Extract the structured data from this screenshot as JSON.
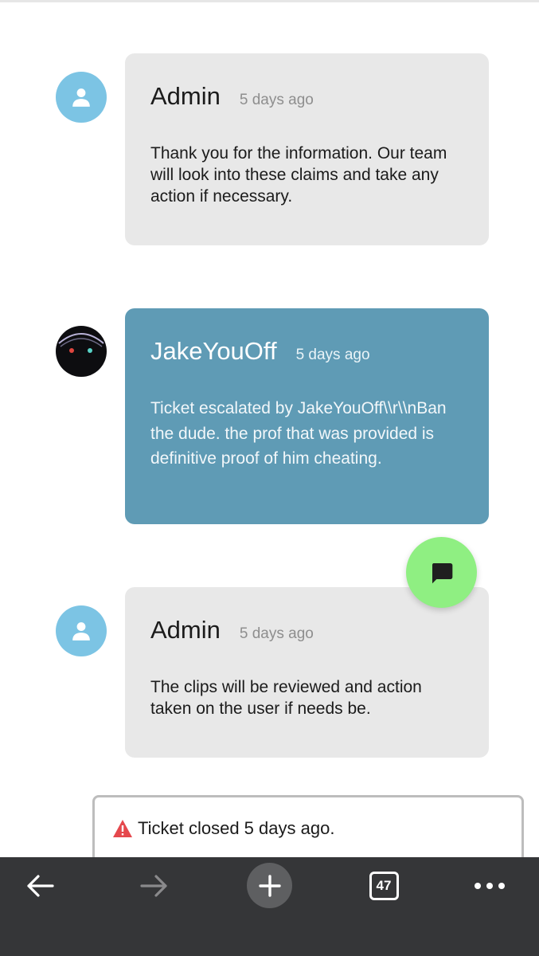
{
  "messages": [
    {
      "author": "Admin",
      "time": "5 days ago",
      "text": "Thank you for the information. Our team will look into these claims and take any action if necessary."
    },
    {
      "author": "JakeYouOff",
      "time": "5 days ago",
      "text": "Ticket escalated by JakeYouOff\\\\r\\\\nBan the dude. the prof that was provided is definitive proof of him cheating."
    },
    {
      "author": "Admin",
      "time": "5 days ago",
      "text": "The clips will be reviewed and action taken on the user if needs be."
    }
  ],
  "ticket_status": {
    "text": "Ticket closed 5 days ago.",
    "icon": "warning-icon",
    "icon_color": "#e5484d"
  },
  "browser_toolbar": {
    "tab_count": "47",
    "icons": [
      "back-arrow-icon",
      "forward-arrow-icon",
      "new-tab-icon",
      "tab-switcher-icon",
      "more-menu-icon"
    ]
  },
  "colors": {
    "admin_avatar": "#7cc4e4",
    "admin_bubble": "#e8e8e8",
    "user_bubble": "#5f9bb5",
    "fab": "#8fef82",
    "toolbar": "#353638"
  }
}
